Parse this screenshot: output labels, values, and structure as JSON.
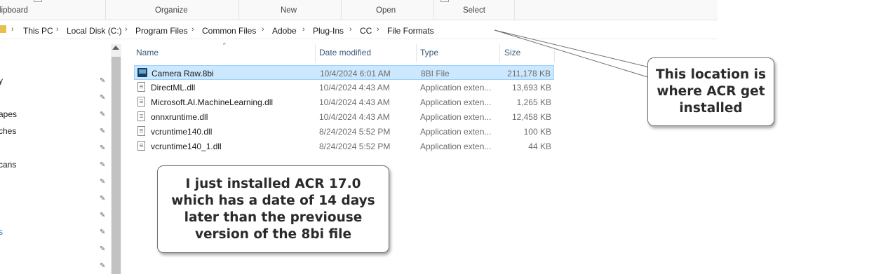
{
  "ribbon": {
    "groups": [
      "lipboard",
      "Organize",
      "New",
      "Open",
      "Select"
    ]
  },
  "address": {
    "crumbs": [
      "This PC",
      "Local Disk (C:)",
      "Program Files",
      "Common Files",
      "Adobe",
      "Plug-Ins",
      "CC",
      "File Formats"
    ]
  },
  "nav": {
    "items": [
      "y",
      "apes",
      "ches",
      "cans",
      "s"
    ]
  },
  "columns": {
    "name": "Name",
    "date": "Date modified",
    "type": "Type",
    "size": "Size"
  },
  "files": [
    {
      "name": "Camera Raw.8bi",
      "date": "10/4/2024 6:01 AM",
      "type": "8BI File",
      "size": "211,178 KB",
      "icon": "camera-raw-icon",
      "selected": true
    },
    {
      "name": "DirectML.dll",
      "date": "10/4/2024 4:43 AM",
      "type": "Application exten...",
      "size": "13,693 KB",
      "icon": "dll-file-icon"
    },
    {
      "name": "Microsoft.AI.MachineLearning.dll",
      "date": "10/4/2024 4:43 AM",
      "type": "Application exten...",
      "size": "1,265 KB",
      "icon": "dll-file-icon"
    },
    {
      "name": "onnxruntime.dll",
      "date": "10/4/2024 4:43 AM",
      "type": "Application exten...",
      "size": "12,458 KB",
      "icon": "dll-file-icon"
    },
    {
      "name": "vcruntime140.dll",
      "date": "8/24/2024 5:52 PM",
      "type": "Application exten...",
      "size": "100 KB",
      "icon": "dll-file-icon"
    },
    {
      "name": "vcruntime140_1.dll",
      "date": "8/24/2024 5:52 PM",
      "type": "Application exten...",
      "size": "44 KB",
      "icon": "dll-file-icon"
    }
  ],
  "callouts": {
    "location": "This location is where ACR get installed",
    "installed": "I just installed ACR 17.0 which has a date of 14 days later than the previouse version of the 8bi file"
  }
}
